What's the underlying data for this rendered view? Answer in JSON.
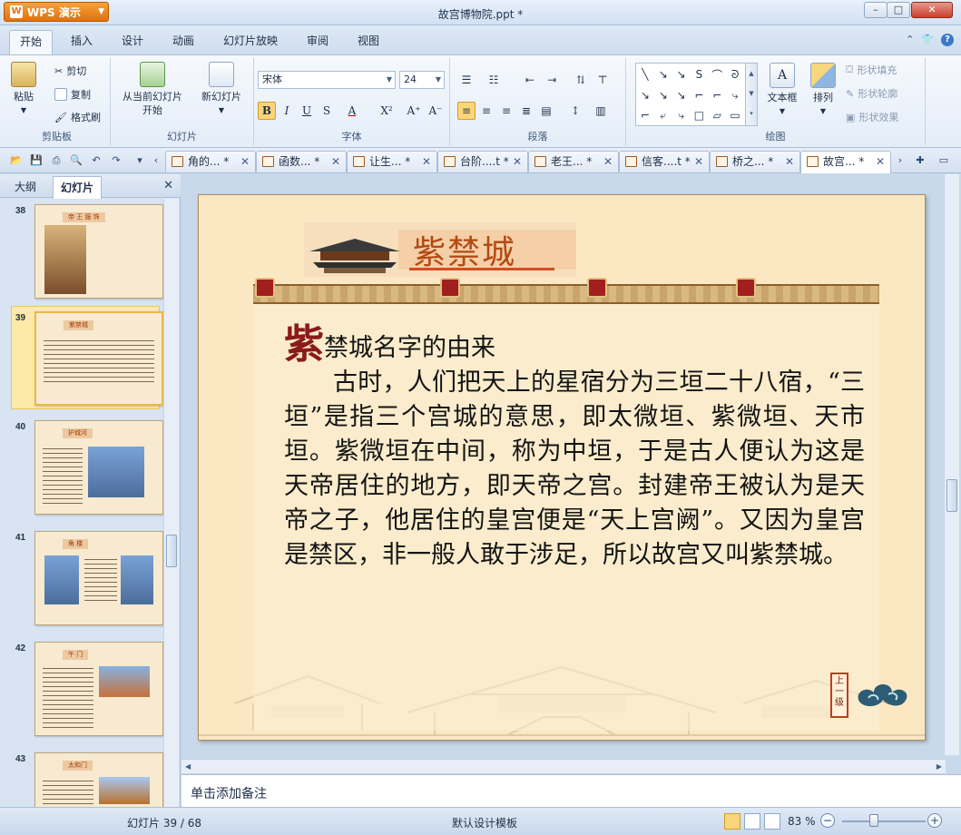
{
  "app": {
    "name": "WPS 演示",
    "doc_title": "故宫博物院.ppt *"
  },
  "window": {
    "min": "–",
    "max": "□",
    "close": "✕"
  },
  "menu": {
    "tabs": [
      "开始",
      "插入",
      "设计",
      "动画",
      "幻灯片放映",
      "审阅",
      "视图"
    ],
    "active": "开始"
  },
  "ribbon": {
    "clipboard": {
      "paste": "粘贴",
      "cut": "剪切",
      "copy": "复制",
      "format_painter": "格式刷",
      "label": "剪贴板"
    },
    "slides": {
      "from_current_1": "从当前幻灯片",
      "from_current_2": "开始",
      "new_slide": "新幻灯片",
      "label": "幻灯片"
    },
    "font": {
      "name": "宋体",
      "size": "24",
      "bold": "B",
      "italic": "I",
      "underline": "U",
      "shadow": "S",
      "color": "A",
      "super_sub": "X²",
      "grow": "A⁺",
      "shrink": "A⁻",
      "label": "字体"
    },
    "paragraph": {
      "label": "段落"
    },
    "drawing": {
      "textbox": "文本框",
      "arrange": "排列",
      "shape_fill": "形状填充",
      "shape_outline": "形状轮廓",
      "shape_effect": "形状效果",
      "label": "绘图"
    },
    "shape_glyphs": [
      "╲",
      "↘",
      "↘",
      "S",
      "⌒",
      "ᘐ",
      "↘",
      "↘",
      "↘",
      "⌐",
      "⌐",
      "⤷",
      "⌐",
      "⤶",
      "⤷",
      "□",
      "▱",
      "▭"
    ]
  },
  "doc_tabs": [
    {
      "label": "角的... *",
      "close": "✕"
    },
    {
      "label": "函数... *",
      "close": "✕"
    },
    {
      "label": "让生... *",
      "close": "✕"
    },
    {
      "label": "台阶....t *",
      "close": "✕"
    },
    {
      "label": "老王... *",
      "close": "✕"
    },
    {
      "label": "信客....t *",
      "close": "✕"
    },
    {
      "label": "桥之... *",
      "close": "✕"
    },
    {
      "label": "故宫... *",
      "close": "✕"
    }
  ],
  "left_panel": {
    "tabs": [
      "大纲",
      "幻灯片"
    ],
    "active": "幻灯片",
    "close": "✕",
    "thumbnails": [
      {
        "num": "38",
        "title": "帝 王 服 饰"
      },
      {
        "num": "39",
        "title": "紫禁城"
      },
      {
        "num": "40",
        "title": "护城河"
      },
      {
        "num": "41",
        "title": "角 楼"
      },
      {
        "num": "42",
        "title": "午 门"
      },
      {
        "num": "43",
        "title": "太和门"
      }
    ]
  },
  "slide": {
    "title": "紫禁城",
    "dropcap": "紫",
    "subhead": "禁城名字的由来",
    "paragraph": "古时，人们把天上的星宿分为三垣二十八宿，“三垣”是指三个宫城的意思，即太微垣、紫微垣、天市垣。紫微垣在中间，称为中垣，于是古人便认为这是天帝居住的地方，即天帝之宫。封建帝王被认为是天帝之子，他居住的皇宫便是“天上宫阙”。又因为皇宫是禁区，非一般人敢于涉足，所以故宫又叫紫禁城。",
    "nav_stamp": "上一级"
  },
  "notes": {
    "placeholder": "单击添加备注"
  },
  "status": {
    "slide_pos": "幻灯片 39 / 68",
    "template": "默认设计模板",
    "zoom": "83 %",
    "zoom_out": "−",
    "zoom_in": "+"
  }
}
